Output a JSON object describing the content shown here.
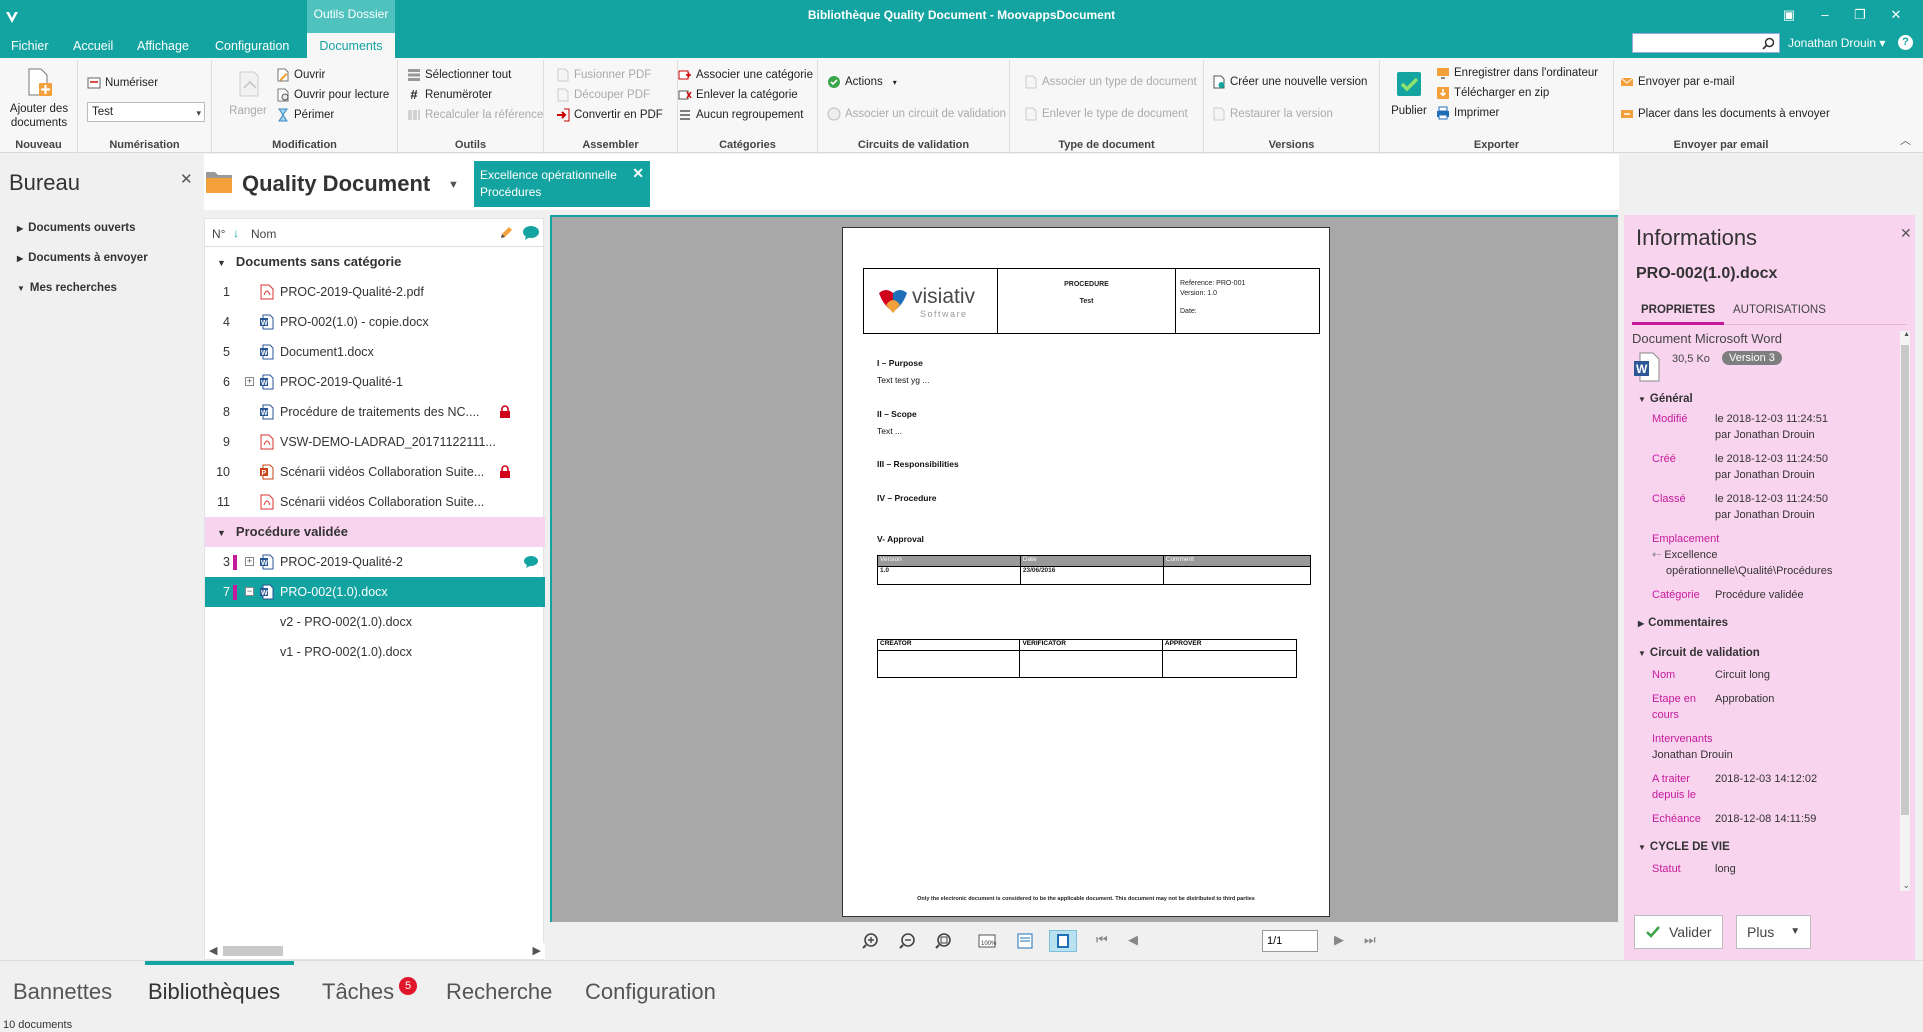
{
  "window": {
    "title": "Bibliothèque Quality Document - MoovappsDocument",
    "context_tab_group": "Outils Dossier",
    "user": "Jonathan Drouin",
    "search_placeholder": ""
  },
  "menu_tabs": [
    {
      "label": "Fichier"
    },
    {
      "label": "Accueil"
    },
    {
      "label": "Affichage"
    },
    {
      "label": "Configuration"
    },
    {
      "label": "Documents"
    }
  ],
  "ribbon": {
    "nouveau": {
      "label": "Nouveau",
      "add": "Ajouter des documents"
    },
    "numerisation": {
      "label": "Numérisation",
      "scan": "Numériser",
      "combo": "Test"
    },
    "modification": {
      "label": "Modification",
      "ranger": "Ranger",
      "ouvrir": "Ouvrir",
      "ouvrir_lecture": "Ouvrir pour lecture",
      "perimer": "Périmer"
    },
    "outils": {
      "label": "Outils",
      "select_all": "Sélectionner tout",
      "renumeroter": "Renumëroter",
      "recalc": "Recalculer la référence"
    },
    "assembler": {
      "label": "Assembler",
      "fusion": "Fusionner PDF",
      "decouper": "Découper PDF",
      "convertir": "Convertir en PDF"
    },
    "categories": {
      "label": "Catégories",
      "associer": "Associer une catégorie",
      "enlever": "Enlever la catégorie",
      "aucun": "Aucun regroupement"
    },
    "circuits": {
      "label": "Circuits de validation",
      "actions": "Actions",
      "associer": "Associer un circuit de validation"
    },
    "type_doc": {
      "label": "Type de document",
      "associer": "Associer un type de document",
      "enlever": "Enlever le type de document"
    },
    "versions": {
      "label": "Versions",
      "creer": "Créer une nouvelle version",
      "restaurer": "Restaurer la version"
    },
    "exporter": {
      "label": "Exporter",
      "publier": "Publier",
      "enregistrer": "Enregistrer dans l'ordinateur",
      "telecharger": "Télécharger en zip",
      "imprimer": "Imprimer"
    },
    "email": {
      "label": "Envoyer par email",
      "envoyer": "Envoyer par e-mail",
      "placer": "Placer dans les documents à envoyer"
    }
  },
  "bureau": {
    "title": "Bureau",
    "items": [
      {
        "label": "Documents ouverts"
      },
      {
        "label": "Documents à envoyer"
      },
      {
        "label": "Mes recherches"
      }
    ]
  },
  "library": {
    "title": "Quality Document",
    "filter_line1": "Excellence opérationnelle",
    "filter_line2": "Procédures",
    "col_no": "N°",
    "col_name": "Nom",
    "groups": [
      {
        "label": "Documents sans catégorie"
      },
      {
        "label": "Procédure validée"
      }
    ],
    "rows": [
      {
        "n": "1",
        "name": "PROC-2019-Qualité-2.pdf",
        "icon": "pdf-icon"
      },
      {
        "n": "4",
        "name": "PRO-002(1.0) - copie.docx",
        "icon": "word-icon"
      },
      {
        "n": "5",
        "name": "Document1.docx",
        "icon": "word-icon"
      },
      {
        "n": "6",
        "name": "PROC-2019-Qualité-1",
        "icon": "word-icon"
      },
      {
        "n": "8",
        "name": "Procédure de traitements des NC....",
        "icon": "word-icon"
      },
      {
        "n": "9",
        "name": "VSW-DEMO-LADRAD_20171122111...",
        "icon": "pdf-icon"
      },
      {
        "n": "10",
        "name": "Scénarii vidéos Collaboration Suite...",
        "icon": "ppt-icon"
      },
      {
        "n": "11",
        "name": "Scénarii vidéos Collaboration Suite...",
        "icon": "pdf-icon"
      },
      {
        "n": "3",
        "name": "PROC-2019-Qualité-2",
        "icon": "word-icon"
      },
      {
        "n": "7",
        "name": "PRO-002(1.0).docx",
        "icon": "word-icon"
      },
      {
        "n": "",
        "name": "v2 - PRO-002(1.0).docx",
        "icon": ""
      },
      {
        "n": "",
        "name": "v1 - PRO-002(1.0).docx",
        "icon": ""
      }
    ]
  },
  "preview": {
    "header_title": "PROCEDURE",
    "header_sub": "Test",
    "logo_word": "visiativ",
    "logo_sub": "Software",
    "ref": "Reference: PRO-001",
    "version": "Version: 1.0",
    "date": "Date:",
    "s1": "I – Purpose",
    "s1t": "Text test yg ...",
    "s2": "II – Scope",
    "s2t": "Text ...",
    "s3": "III – Responsibilities",
    "s4": "IV – Procedure",
    "s5": "V- Approval",
    "t1_headers": [
      "Version",
      "Date",
      "Comment"
    ],
    "t1_row": [
      "1.0",
      "23/06/2016",
      ""
    ],
    "t2_headers": [
      "CREATOR",
      "VERIFICATOR",
      "APPROVER"
    ],
    "footer": "Only the electronic document is considered to be the applicable document. This document may not be distributed to third parties",
    "page_value": "1/1"
  },
  "info": {
    "title": "Informations",
    "filename": "PRO-002(1.0).docx",
    "tab_props": "PROPRIETES",
    "tab_auth": "AUTORISATIONS",
    "doc_type": "Document Microsoft Word",
    "size": "30,5 Ko",
    "version_badge": "Version 3",
    "general": "Général",
    "modifie_l": "Modifié",
    "modifie_v1": "le 2018-12-03 11:24:51",
    "modifie_v2": "par Jonathan Drouin",
    "cree_l": "Créé",
    "cree_v1": "le 2018-12-03 11:24:50",
    "cree_v2": "par Jonathan Drouin",
    "classe_l": "Classé",
    "classe_v1": "le 2018-12-03 11:24:50",
    "classe_v2": "par Jonathan Drouin",
    "empl_l": "Emplacement",
    "empl_v1": "Excellence",
    "empl_v2": "opérationnelle\\Qualité\\Procédures",
    "cat_l": "Catégorie",
    "cat_v": "Procédure validée",
    "commentaires": "Commentaires",
    "circuit": "Circuit de validation",
    "nom_l": "Nom",
    "nom_v": "Circuit long",
    "etape_l1": "Etape en",
    "etape_l2": "cours",
    "etape_v": "Approbation",
    "interv_l": "Intervenants",
    "interv_v": "Jonathan Drouin",
    "atraiter_l1": "A traiter",
    "atraiter_l2": "depuis le",
    "atraiter_v": "2018-12-03 14:12:02",
    "echeance_l": "Echéance",
    "echeance_v": "2018-12-08 14:11:59",
    "cycle": "CYCLE DE VIE",
    "statut_l": "Statut",
    "statut_v": "long",
    "valider": "Valider",
    "plus": "Plus"
  },
  "bottom_tabs": [
    {
      "label": "Bannettes"
    },
    {
      "label": "Bibliothèques"
    },
    {
      "label": "Tâches"
    },
    {
      "label": "Recherche"
    },
    {
      "label": "Configuration"
    }
  ],
  "tasks_badge": "5",
  "status": "10 documents",
  "colors": {
    "accent": "#13a3a0",
    "pink_panel": "#f9d4ef",
    "magenta": "#c51a9b",
    "badge_red": "#e0162b"
  }
}
